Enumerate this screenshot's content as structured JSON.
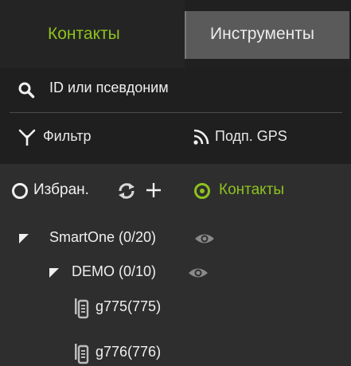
{
  "tabs": {
    "contacts_label": "Контакты",
    "tools_label": "Инструменты"
  },
  "toolbar": {
    "search_placeholder": "ID или псевдоним",
    "filter_label": "Фильтр",
    "gps_label": "Подп. GPS"
  },
  "options": {
    "favorites_label": "Избран.",
    "contacts_label": "Контакты",
    "selected": "contacts"
  },
  "tree": {
    "group": {
      "label": "SmartOne (0/20)"
    },
    "subgroup": {
      "label": "DEMO (0/10)"
    },
    "devices": [
      {
        "label": "g775(775)"
      },
      {
        "label": "g776(776)"
      }
    ]
  },
  "colors": {
    "accent": "#8ec21f",
    "background": "#2e2e2e",
    "toolbar": "#1f1f1f",
    "inactive_tab": "#5a5a5a"
  },
  "icons": {
    "search": "search-icon",
    "filter": "antenna-filter-icon",
    "gps": "rss-feed-icon",
    "refresh": "refresh-icon",
    "add": "plus-icon",
    "visibility": "eye-icon",
    "device": "walkie-talkie-icon",
    "expand": "expanded-caret-icon"
  }
}
